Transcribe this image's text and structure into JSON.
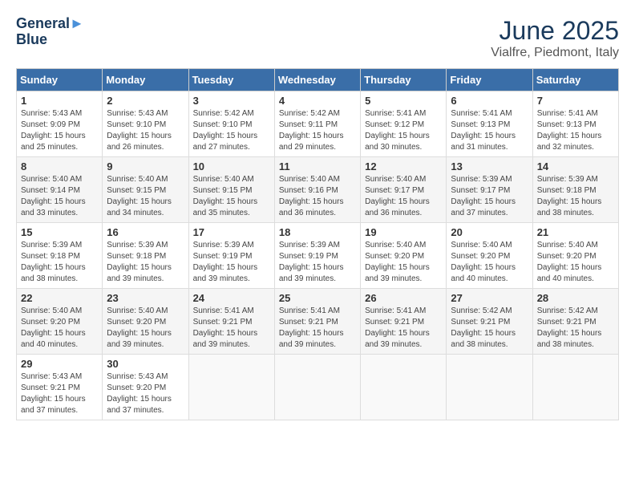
{
  "header": {
    "logo_line1": "General",
    "logo_line2": "Blue",
    "month_title": "June 2025",
    "location": "Vialfre, Piedmont, Italy"
  },
  "days_of_week": [
    "Sunday",
    "Monday",
    "Tuesday",
    "Wednesday",
    "Thursday",
    "Friday",
    "Saturday"
  ],
  "weeks": [
    [
      {
        "day": "1",
        "info": "Sunrise: 5:43 AM\nSunset: 9:09 PM\nDaylight: 15 hours and 25 minutes."
      },
      {
        "day": "2",
        "info": "Sunrise: 5:43 AM\nSunset: 9:10 PM\nDaylight: 15 hours and 26 minutes."
      },
      {
        "day": "3",
        "info": "Sunrise: 5:42 AM\nSunset: 9:10 PM\nDaylight: 15 hours and 27 minutes."
      },
      {
        "day": "4",
        "info": "Sunrise: 5:42 AM\nSunset: 9:11 PM\nDaylight: 15 hours and 29 minutes."
      },
      {
        "day": "5",
        "info": "Sunrise: 5:41 AM\nSunset: 9:12 PM\nDaylight: 15 hours and 30 minutes."
      },
      {
        "day": "6",
        "info": "Sunrise: 5:41 AM\nSunset: 9:13 PM\nDaylight: 15 hours and 31 minutes."
      },
      {
        "day": "7",
        "info": "Sunrise: 5:41 AM\nSunset: 9:13 PM\nDaylight: 15 hours and 32 minutes."
      }
    ],
    [
      {
        "day": "8",
        "info": "Sunrise: 5:40 AM\nSunset: 9:14 PM\nDaylight: 15 hours and 33 minutes."
      },
      {
        "day": "9",
        "info": "Sunrise: 5:40 AM\nSunset: 9:15 PM\nDaylight: 15 hours and 34 minutes."
      },
      {
        "day": "10",
        "info": "Sunrise: 5:40 AM\nSunset: 9:15 PM\nDaylight: 15 hours and 35 minutes."
      },
      {
        "day": "11",
        "info": "Sunrise: 5:40 AM\nSunset: 9:16 PM\nDaylight: 15 hours and 36 minutes."
      },
      {
        "day": "12",
        "info": "Sunrise: 5:40 AM\nSunset: 9:17 PM\nDaylight: 15 hours and 36 minutes."
      },
      {
        "day": "13",
        "info": "Sunrise: 5:39 AM\nSunset: 9:17 PM\nDaylight: 15 hours and 37 minutes."
      },
      {
        "day": "14",
        "info": "Sunrise: 5:39 AM\nSunset: 9:18 PM\nDaylight: 15 hours and 38 minutes."
      }
    ],
    [
      {
        "day": "15",
        "info": "Sunrise: 5:39 AM\nSunset: 9:18 PM\nDaylight: 15 hours and 38 minutes."
      },
      {
        "day": "16",
        "info": "Sunrise: 5:39 AM\nSunset: 9:18 PM\nDaylight: 15 hours and 39 minutes."
      },
      {
        "day": "17",
        "info": "Sunrise: 5:39 AM\nSunset: 9:19 PM\nDaylight: 15 hours and 39 minutes."
      },
      {
        "day": "18",
        "info": "Sunrise: 5:39 AM\nSunset: 9:19 PM\nDaylight: 15 hours and 39 minutes."
      },
      {
        "day": "19",
        "info": "Sunrise: 5:40 AM\nSunset: 9:20 PM\nDaylight: 15 hours and 39 minutes."
      },
      {
        "day": "20",
        "info": "Sunrise: 5:40 AM\nSunset: 9:20 PM\nDaylight: 15 hours and 40 minutes."
      },
      {
        "day": "21",
        "info": "Sunrise: 5:40 AM\nSunset: 9:20 PM\nDaylight: 15 hours and 40 minutes."
      }
    ],
    [
      {
        "day": "22",
        "info": "Sunrise: 5:40 AM\nSunset: 9:20 PM\nDaylight: 15 hours and 40 minutes."
      },
      {
        "day": "23",
        "info": "Sunrise: 5:40 AM\nSunset: 9:20 PM\nDaylight: 15 hours and 39 minutes."
      },
      {
        "day": "24",
        "info": "Sunrise: 5:41 AM\nSunset: 9:21 PM\nDaylight: 15 hours and 39 minutes."
      },
      {
        "day": "25",
        "info": "Sunrise: 5:41 AM\nSunset: 9:21 PM\nDaylight: 15 hours and 39 minutes."
      },
      {
        "day": "26",
        "info": "Sunrise: 5:41 AM\nSunset: 9:21 PM\nDaylight: 15 hours and 39 minutes."
      },
      {
        "day": "27",
        "info": "Sunrise: 5:42 AM\nSunset: 9:21 PM\nDaylight: 15 hours and 38 minutes."
      },
      {
        "day": "28",
        "info": "Sunrise: 5:42 AM\nSunset: 9:21 PM\nDaylight: 15 hours and 38 minutes."
      }
    ],
    [
      {
        "day": "29",
        "info": "Sunrise: 5:43 AM\nSunset: 9:21 PM\nDaylight: 15 hours and 37 minutes."
      },
      {
        "day": "30",
        "info": "Sunrise: 5:43 AM\nSunset: 9:20 PM\nDaylight: 15 hours and 37 minutes."
      },
      {
        "day": "",
        "info": ""
      },
      {
        "day": "",
        "info": ""
      },
      {
        "day": "",
        "info": ""
      },
      {
        "day": "",
        "info": ""
      },
      {
        "day": "",
        "info": ""
      }
    ]
  ]
}
